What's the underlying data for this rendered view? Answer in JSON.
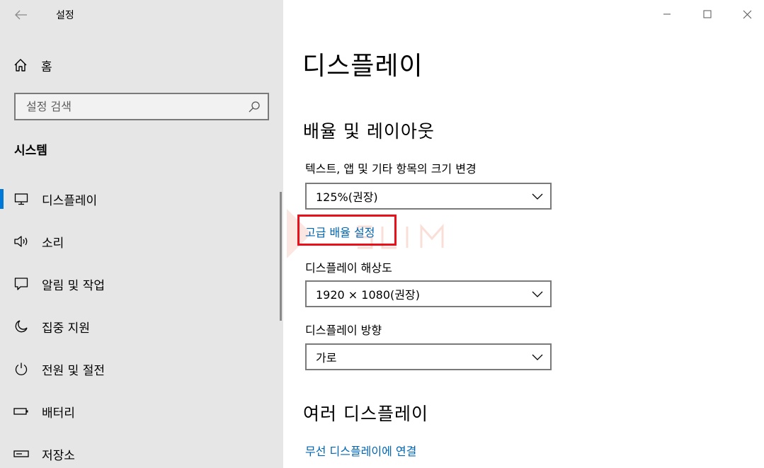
{
  "app": {
    "title": "설정"
  },
  "sidebar": {
    "home_label": "홈",
    "search_placeholder": "설정 검색",
    "section_label": "시스템",
    "items": [
      {
        "label": "디스플레이",
        "icon": "monitor-icon",
        "selected": true
      },
      {
        "label": "소리",
        "icon": "speaker-icon"
      },
      {
        "label": "알림 및 작업",
        "icon": "notification-icon"
      },
      {
        "label": "집중 지원",
        "icon": "moon-icon"
      },
      {
        "label": "전원 및 절전",
        "icon": "power-icon"
      },
      {
        "label": "배터리",
        "icon": "battery-icon"
      },
      {
        "label": "저장소",
        "icon": "storage-icon"
      }
    ]
  },
  "main": {
    "title": "디스플레이",
    "scale_section": {
      "heading": "배율 및 레이아웃",
      "scale_label": "텍스트, 앱 및 기타 항목의 크기 변경",
      "scale_value": "125%(권장)",
      "advanced_link": "고급 배율 설정",
      "resolution_label": "디스플레이 해상도",
      "resolution_value": "1920 × 1080(권장)",
      "orientation_label": "디스플레이 방향",
      "orientation_value": "가로"
    },
    "multi_section": {
      "heading": "여러 디스플레이",
      "wireless_link": "무선 디스플레이에 연결"
    }
  },
  "colors": {
    "accent": "#0078d7",
    "link": "#0066b4",
    "highlight": "#e8101b",
    "sidebar_bg": "#e6e6e6"
  }
}
